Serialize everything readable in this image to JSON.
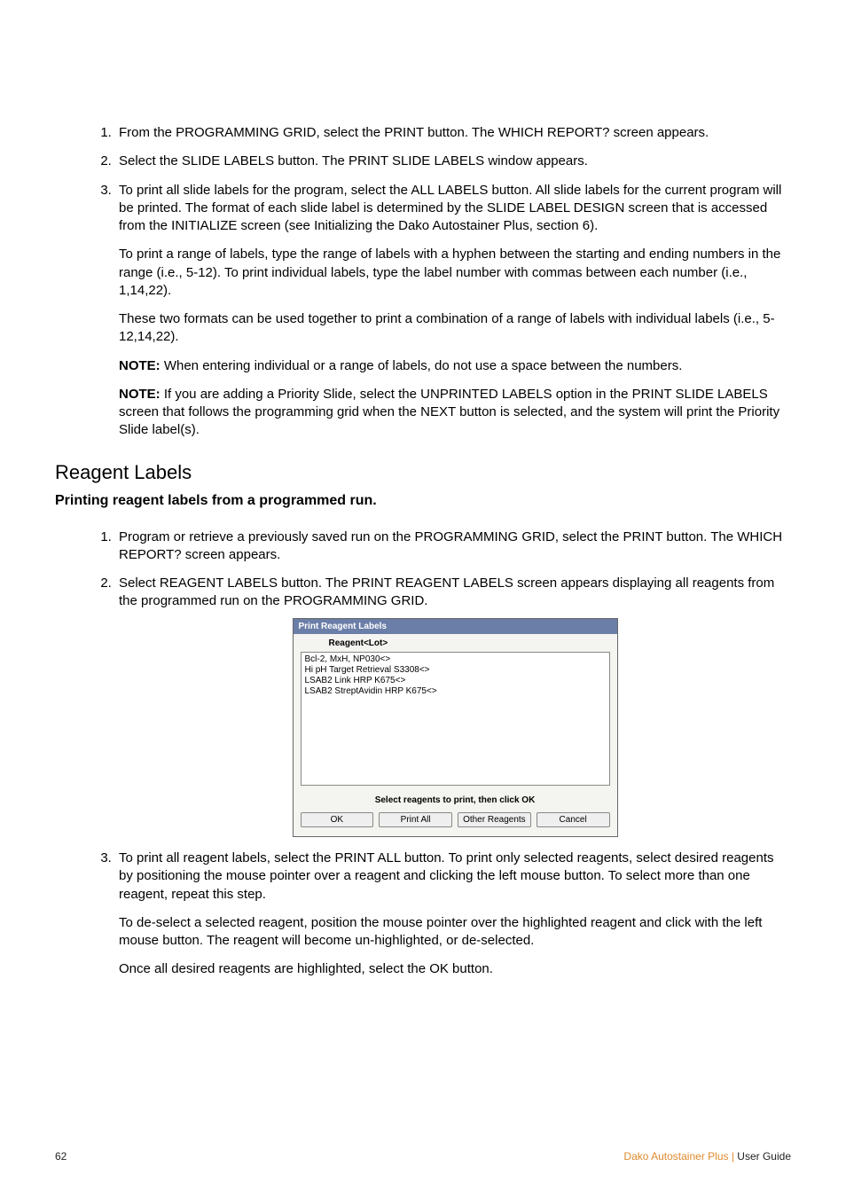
{
  "list_a": {
    "item1": "From the PROGRAMMING GRID, select the PRINT button. The WHICH REPORT? screen appears.",
    "item2": "Select the SLIDE LABELS button. The PRINT SLIDE LABELS window appears.",
    "item3_p1": "To print all slide labels for the program, select the ALL LABELS button. All slide labels for the current program will be printed. The format of each slide label is determined by the SLIDE LABEL DESIGN screen that is accessed from the INITIALIZE screen (see Initializing the Dako Autostainer Plus, section 6).",
    "item3_p2": "To print a range of labels, type the range of labels with a hyphen between the starting and ending numbers in the range (i.e., 5-12). To print individual labels, type the label number with commas between each number (i.e., 1,14,22).",
    "item3_p3": "These two formats can be used together to print a combination of a range of labels with individual labels (i.e., 5-12,14,22).",
    "item3_note1_label": "NOTE:",
    "item3_note1": "  When entering individual or a range of labels, do not use a space between the numbers.",
    "item3_note2_label": "NOTE:",
    "item3_note2": "  If you are adding a Priority Slide, select the UNPRINTED LABELS option in the PRINT SLIDE LABELS screen that follows the programming grid when the NEXT button is selected, and the system will print the Priority Slide label(s)."
  },
  "section_heading": "Reagent Labels",
  "sub_heading": "Printing reagent labels from a programmed run.",
  "list_b": {
    "item1": "Program or retrieve a previously saved run on the PROGRAMMING GRID, select the PRINT button. The WHICH REPORT? screen appears.",
    "item2": "Select REAGENT LABELS button. The PRINT REAGENT LABELS screen appears displaying all reagents from the programmed run on the PROGRAMMING GRID.",
    "item3_p1": "To print all reagent labels, select the PRINT ALL button. To print only selected reagents, select desired reagents by positioning the mouse pointer over a reagent and clicking the left mouse button. To select more than one reagent, repeat this step.",
    "item3_p2": "To de-select a selected reagent, position the mouse pointer over the highlighted reagent and click with the left mouse button. The reagent will become un-highlighted, or de-selected.",
    "item3_p3": "Once all desired reagents are highlighted, select the OK button."
  },
  "dialog": {
    "title": "Print Reagent Labels",
    "col_header": "Reagent<Lot>",
    "rows": [
      "Bcl-2, MxH, NP030<>",
      "Hi pH Target Retrieval S3308<>",
      "LSAB2 Link HRP K675<>",
      "LSAB2 StreptAvidin HRP K675<>"
    ],
    "instruction": "Select reagents to print, then click OK",
    "buttons": {
      "ok": "OK",
      "print_all": "Print All",
      "other": "Other Reagents",
      "cancel": "Cancel"
    }
  },
  "footer": {
    "page": "62",
    "product": "Dako Autostainer Plus",
    "sep": " | ",
    "doc": "User Guide"
  }
}
